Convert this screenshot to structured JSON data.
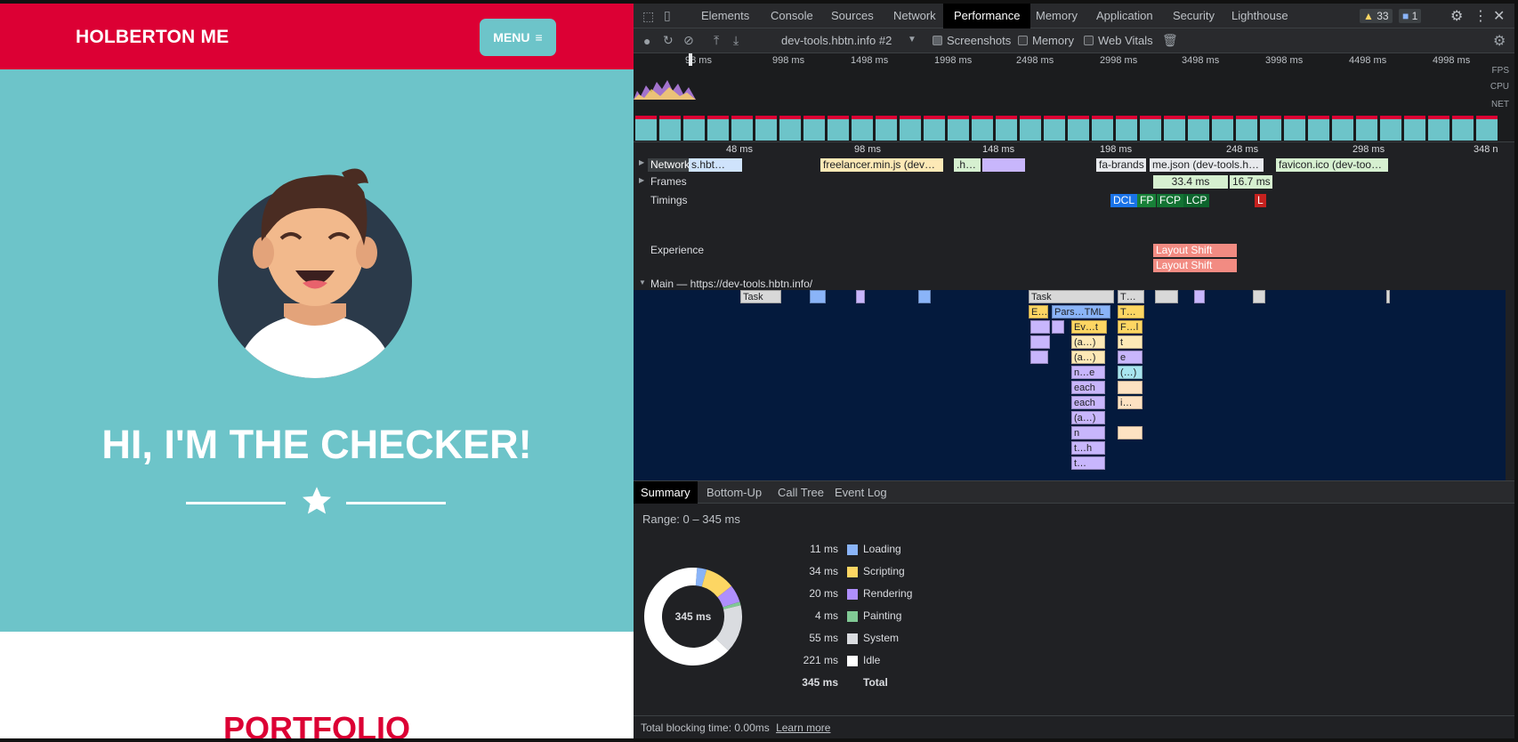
{
  "page": {
    "brand": "HOLBERTON ME",
    "menu_label": "MENU",
    "hero_title": "HI, I'M THE CHECKER!",
    "section_title": "PORTFOLIO",
    "colors": {
      "navbar": "#dc0034",
      "hero": "#6dc4c9",
      "accent": "#dc0034"
    }
  },
  "devtools": {
    "tabs": [
      "Elements",
      "Console",
      "Sources",
      "Network",
      "Performance",
      "Memory",
      "Application",
      "Security",
      "Lighthouse"
    ],
    "active_tab": "Performance",
    "warnings": "33",
    "messages": "1",
    "toolbar": {
      "profile": "dev-tools.hbtn.info #2",
      "screenshots": "Screenshots",
      "memory": "Memory",
      "web_vitals": "Web Vitals"
    },
    "overview_ticks": [
      "98 ms",
      "998 ms",
      "1498 ms",
      "1998 ms",
      "2498 ms",
      "2998 ms",
      "3498 ms",
      "3998 ms",
      "4498 ms",
      "4998 ms"
    ],
    "overview_labels": [
      "FPS",
      "CPU",
      "NET"
    ],
    "ruler_ticks": [
      "48 ms",
      "98 ms",
      "148 ms",
      "198 ms",
      "248 ms",
      "298 ms",
      "348 n"
    ],
    "tracks": {
      "network": "Network",
      "frames": "Frames",
      "timings": "Timings",
      "experience": "Experience",
      "main": "Main — https://dev-tools.hbtn.info/"
    },
    "network_items": [
      "s.hbt…",
      "freelancer.min.js (dev…",
      ".h…",
      "fa-brands",
      "me.json (dev-tools.h…",
      "favicon.ico (dev-too…"
    ],
    "frames": [
      "33.4 ms",
      "16.7 ms"
    ],
    "timings": [
      "DCL",
      "FP",
      "FCP",
      "LCP",
      "L"
    ],
    "layout_shifts": [
      "Layout Shift",
      "Layout Shift"
    ],
    "flame": {
      "task1": "Task",
      "task2": "Task",
      "task3": "T…",
      "e": "E…",
      "parse": "Pars…TML",
      "t": "T…",
      "evt": "Ev…t",
      "fl": "F…l",
      "a1": "(a…)",
      "tt": "t",
      "a2": "(a…)",
      "ee": "e",
      "ne": "n…e",
      "dots": "(…)",
      "each1": "each",
      "i": "i…",
      "each2": "each",
      "a3": "(a…)",
      "n": "n",
      "th": "t…h",
      "t2": "t…"
    },
    "bottom_tabs": [
      "Summary",
      "Bottom-Up",
      "Call Tree",
      "Event Log"
    ],
    "summary": {
      "range": "Range: 0 – 345 ms",
      "total_center": "345 ms",
      "rows": [
        {
          "value": "11 ms",
          "name": "Loading",
          "color": "#8ab4f8"
        },
        {
          "value": "34 ms",
          "name": "Scripting",
          "color": "#fdd663"
        },
        {
          "value": "20 ms",
          "name": "Rendering",
          "color": "#af8ffd"
        },
        {
          "value": "4 ms",
          "name": "Painting",
          "color": "#81c995"
        },
        {
          "value": "55 ms",
          "name": "System",
          "color": "#dadce0"
        },
        {
          "value": "221 ms",
          "name": "Idle",
          "color": "#ffffff"
        },
        {
          "value": "345 ms",
          "name": "Total",
          "color": ""
        }
      ]
    },
    "status": {
      "text": "Total blocking time: 0.00ms",
      "link": "Learn more"
    }
  }
}
